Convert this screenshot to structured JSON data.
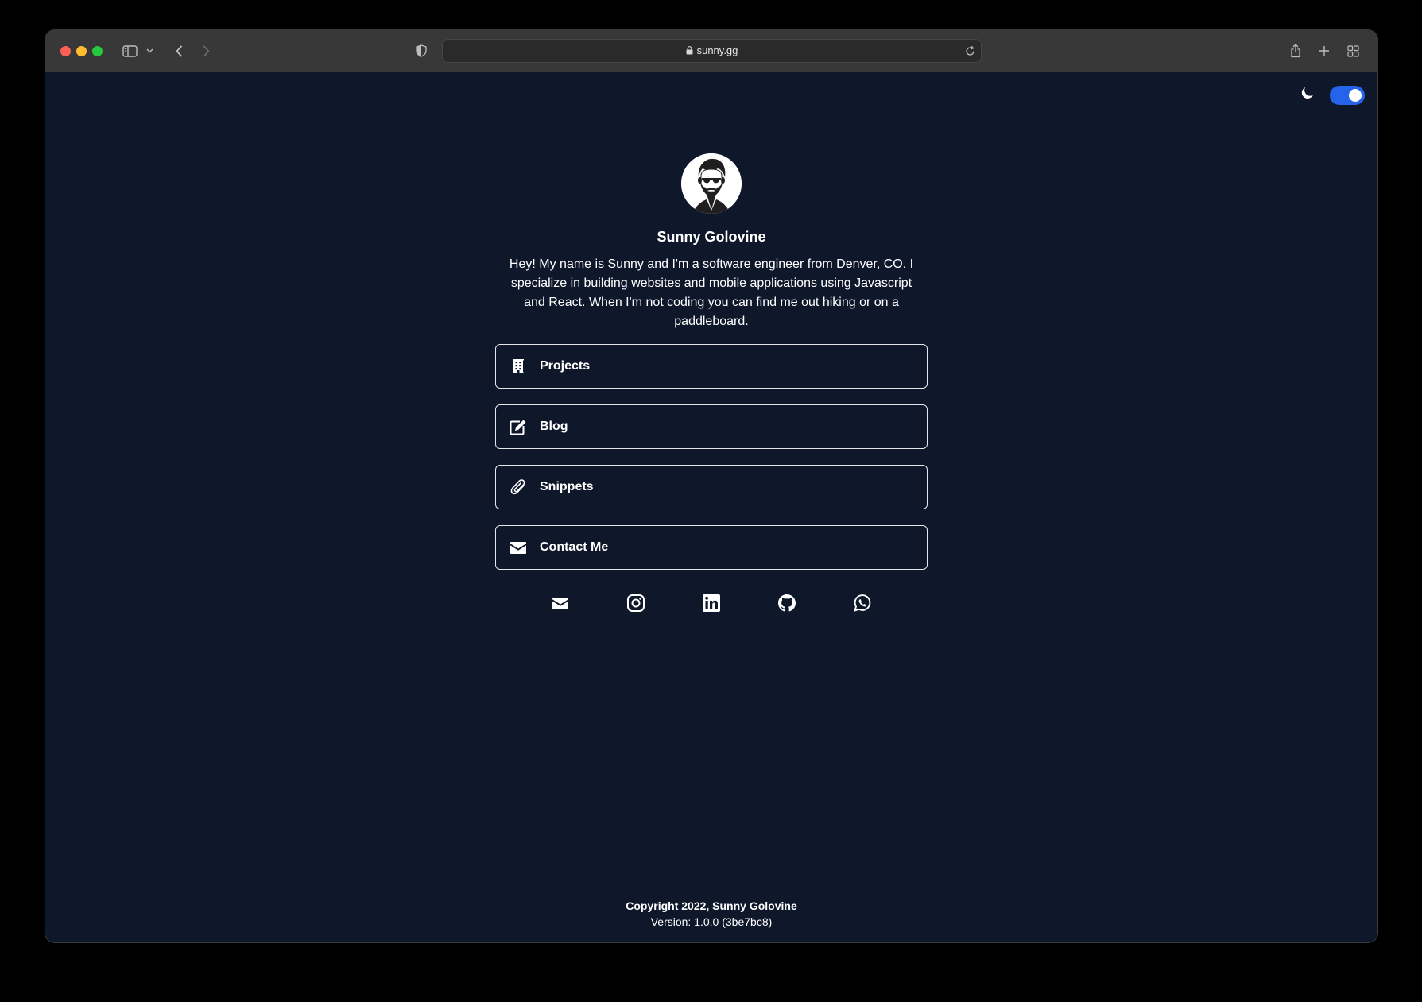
{
  "browser": {
    "url": "sunny.gg",
    "icons": [
      "sidebar-icon",
      "chevron-down-icon",
      "back-icon",
      "forward-icon",
      "shield-icon",
      "lock-icon",
      "reload-icon",
      "share-icon",
      "plus-icon",
      "tabs-grid-icon"
    ]
  },
  "theme": {
    "mode_icon": "moon-icon",
    "dark_mode_enabled": true,
    "accent": "#2563eb",
    "background": "#0f172a"
  },
  "profile": {
    "name": "Sunny Golovine",
    "bio": "Hey! My name is Sunny and I'm a software engineer from Denver, CO. I specialize in building websites and mobile applications using Javascript and React. When I'm not coding you can find me out hiking or on a paddleboard."
  },
  "links": [
    {
      "label": "Projects",
      "icon": "building-icon"
    },
    {
      "label": "Blog",
      "icon": "edit-icon"
    },
    {
      "label": "Snippets",
      "icon": "paperclip-icon"
    },
    {
      "label": "Contact Me",
      "icon": "envelope-icon"
    }
  ],
  "socials": [
    "email-icon",
    "instagram-icon",
    "linkedin-icon",
    "github-icon",
    "whatsapp-icon"
  ],
  "footer": {
    "copyright": "Copyright 2022, Sunny Golovine",
    "version": "Version: 1.0.0 (3be7bc8)"
  }
}
